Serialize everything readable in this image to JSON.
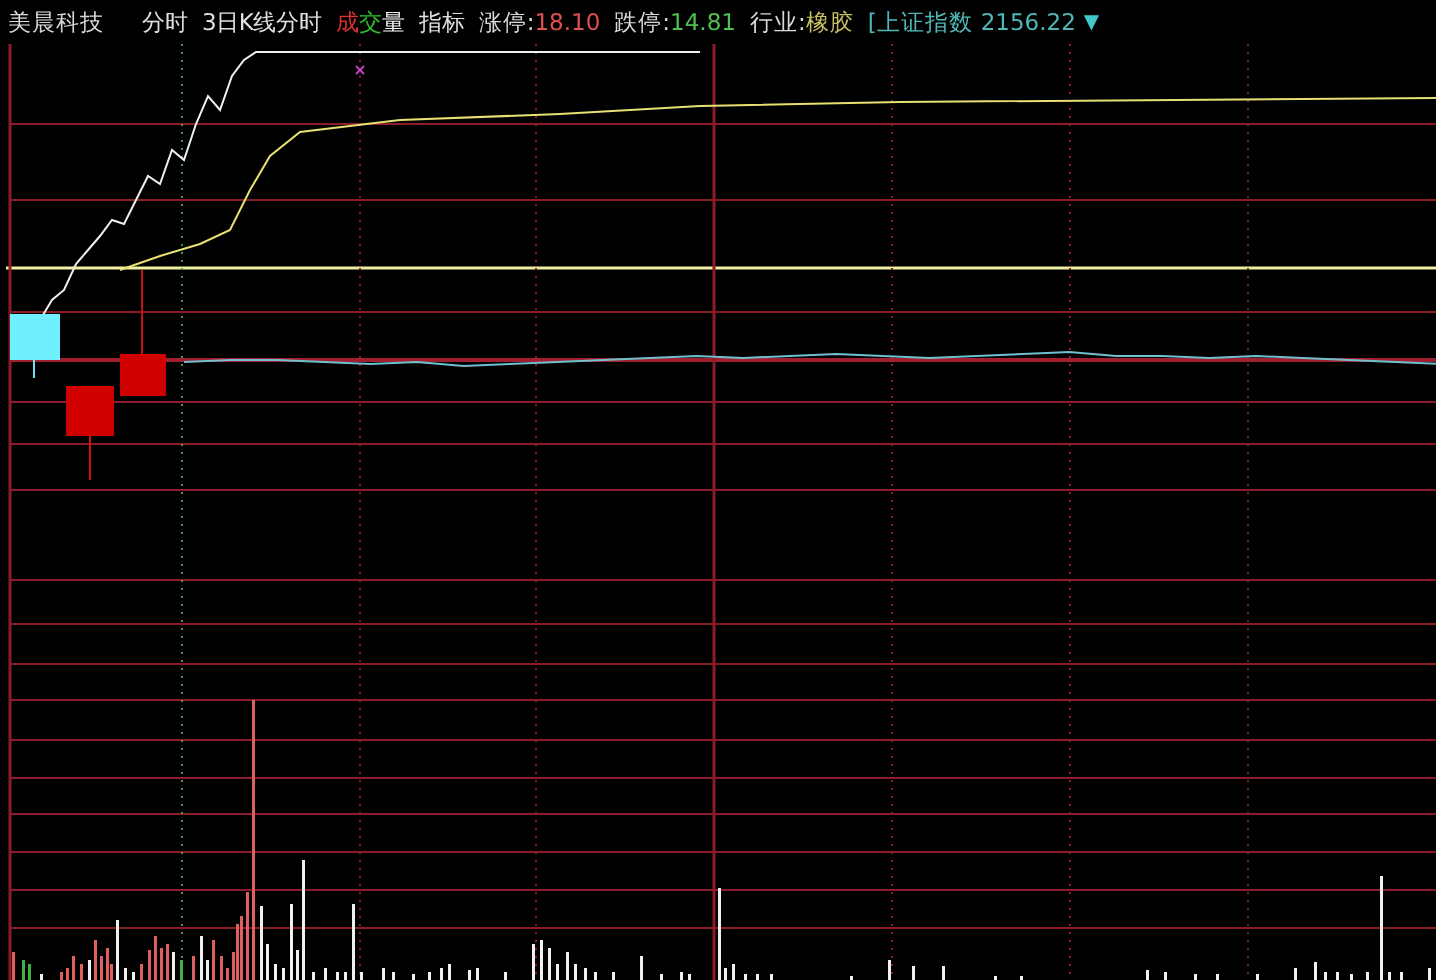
{
  "stock": {
    "name": "美晨科技"
  },
  "toolbar": [
    {
      "label": "分时",
      "kind": "plain"
    },
    {
      "label": "3日K线分时",
      "kind": "plain"
    },
    {
      "label": "成交量",
      "kind": "volume"
    },
    {
      "label": "指标",
      "kind": "plain"
    }
  ],
  "limits": [
    {
      "label": "涨停:",
      "value": "18.10",
      "kind": "up"
    },
    {
      "label": "跌停:",
      "value": "14.81",
      "kind": "down"
    }
  ],
  "industry": {
    "label": "行业:",
    "value": "橡胶"
  },
  "index": {
    "name": "[上证指数",
    "value": "2156.22",
    "marker": "▼"
  }
}
